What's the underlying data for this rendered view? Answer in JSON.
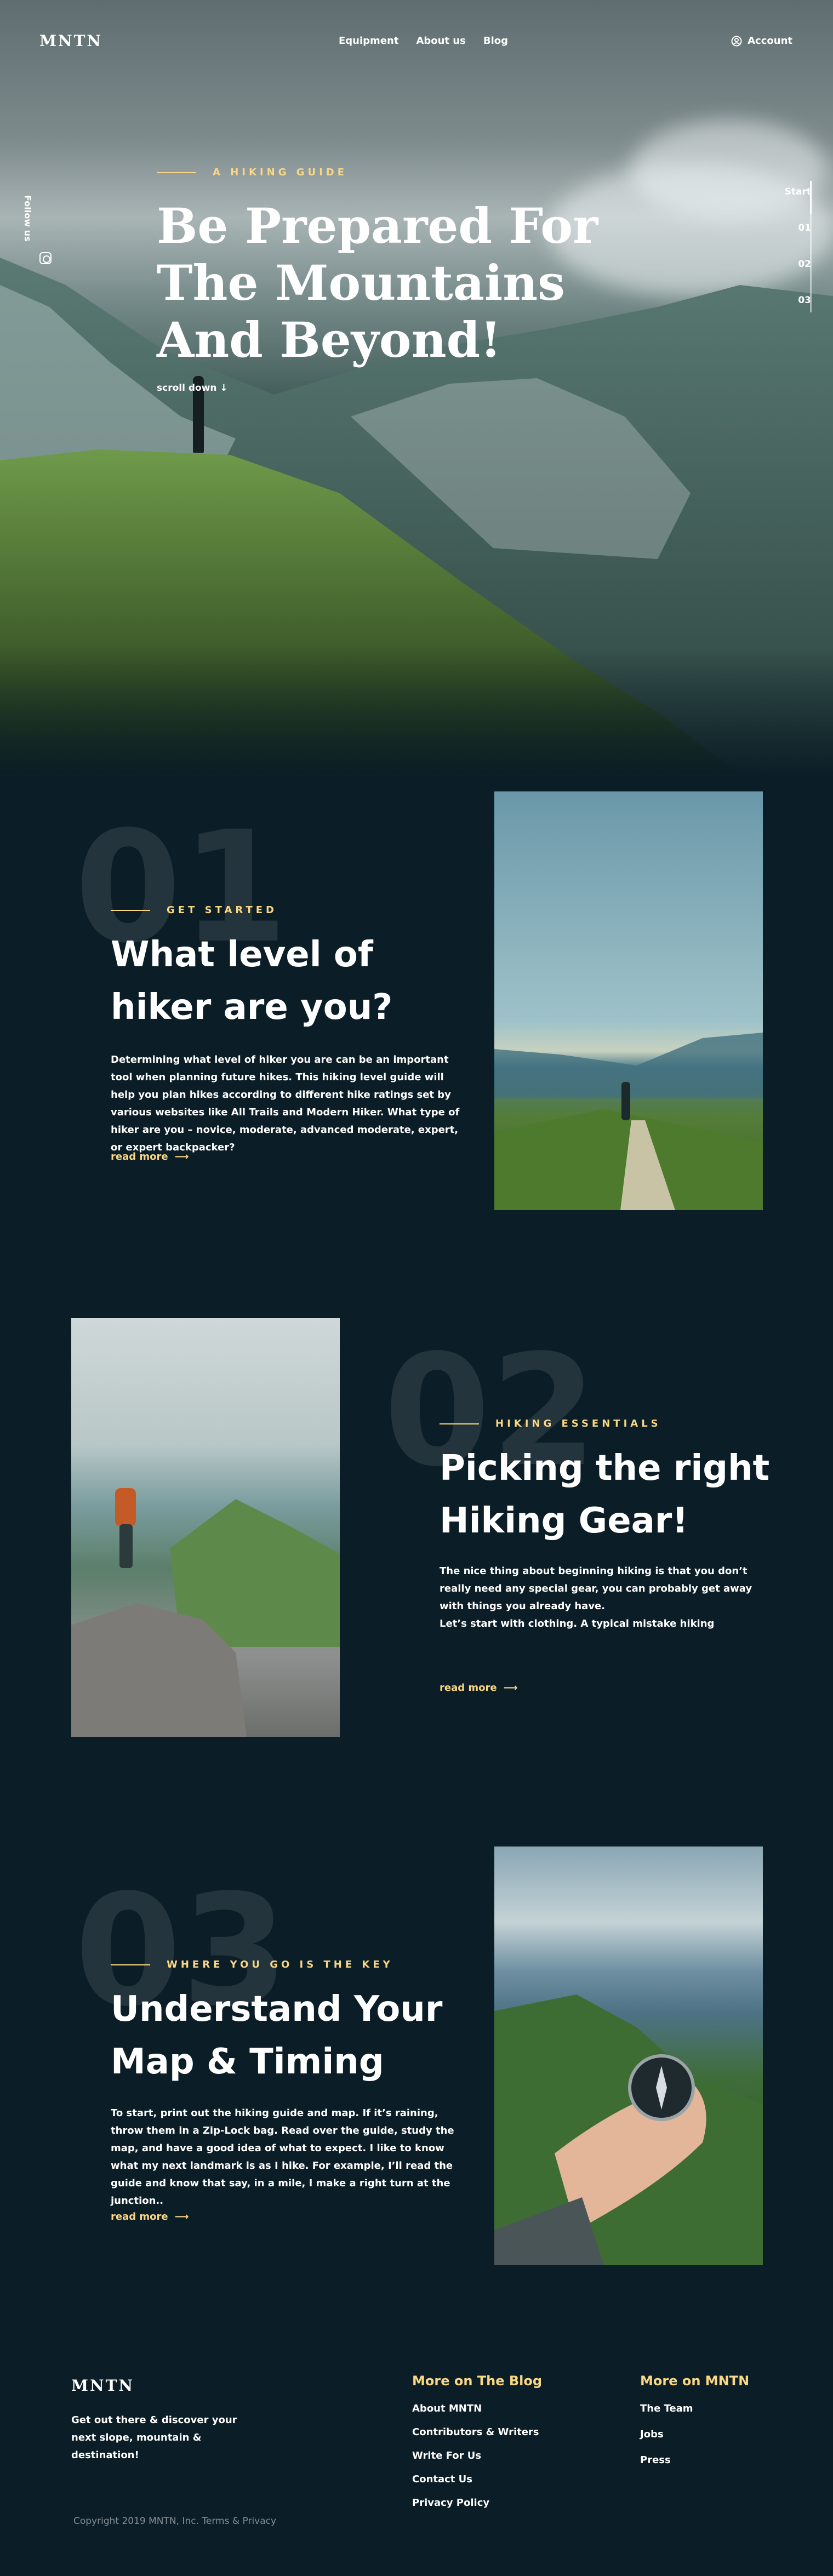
{
  "nav": {
    "logo": "MNTN",
    "links": [
      "Equipment",
      "About us",
      "Blog"
    ],
    "account": "Account"
  },
  "hero": {
    "follow": "Follow us",
    "eyebrow": "A HIKING GUIDE",
    "title": "Be Prepared For The Mountains And Beyond!",
    "scroll": "scroll down",
    "steps": [
      "Start",
      "01",
      "02",
      "03"
    ]
  },
  "sections": [
    {
      "number": "01",
      "eyebrow": "GET STARTED",
      "title": "What level of hiker are you?",
      "body": "Determining what level of hiker you are can be an important tool when planning future hikes. This hiking level guide will help you plan hikes according to different hike ratings set by various websites like All Trails and Modern Hiker. What type of hiker are you – novice, moderate, advanced moderate, expert, or expert backpacker?",
      "read_more": "read more"
    },
    {
      "number": "02",
      "eyebrow": "HIKING ESSENTIALS",
      "title": "Picking the right Hiking Gear!",
      "body": "The nice thing about beginning hiking is that you don’t really need any special gear, you can probably get away with things you already have.\nLet’s start with clothing. A typical mistake hiking beginners make is wearing jeans and regular clothes, which will get heavy and chafe wif they get sweaty or wet.",
      "read_more": "read more"
    },
    {
      "number": "03",
      "eyebrow": "WHERE YOU GO IS THE KEY",
      "title": "Understand Your Map & Timing",
      "body": "To start, print out the hiking guide and map. If it’s raining, throw them in a Zip-Lock bag. Read over the guide, study the map, and have a good idea of what to expect. I like to know what my next landmark is as I hike. For example, I’ll read the guide and know that say, in a mile, I make a right turn at the junction..",
      "read_more": "read more"
    }
  ],
  "footer": {
    "logo": "MNTN",
    "tagline": "Get out there & discover your next slope, mountain & destination!",
    "copyright": "Copyright 2019 MNTN, Inc. Terms & Privacy",
    "blog_title": "More on The Blog",
    "blog_links": [
      "About MNTN",
      "Contributors & Writers",
      "Write For Us",
      "Contact Us",
      "Privacy Policy"
    ],
    "mntn_title": "More on MNTN",
    "mntn_links": [
      "The Team",
      "Jobs",
      "Press"
    ]
  },
  "colors": {
    "background": "#0b1d26",
    "accent": "#fbd784"
  }
}
